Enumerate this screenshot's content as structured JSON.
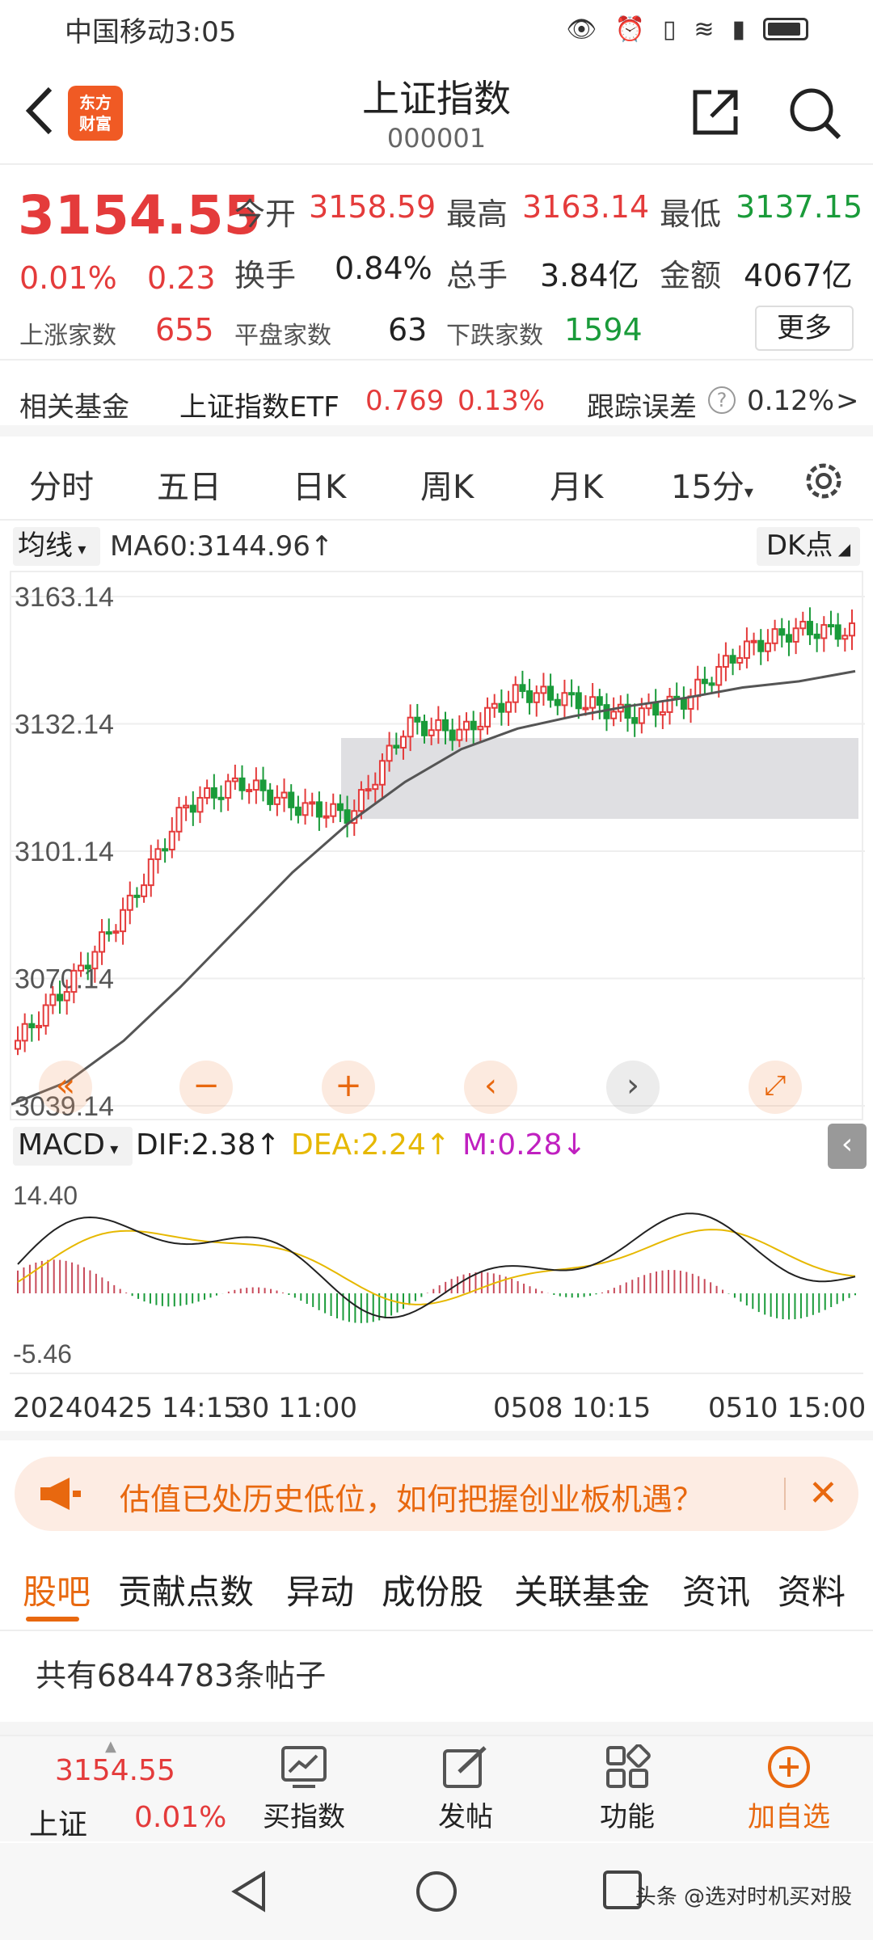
{
  "status": {
    "carrier_time": "中国移动3:05"
  },
  "nav": {
    "logo": "东方财富",
    "title": "上证指数",
    "code": "000001"
  },
  "quote": {
    "price": "3154.55",
    "change_pct": "0.01%",
    "change_val": "0.23",
    "open_label": "今开",
    "open": "3158.59",
    "high_label": "最高",
    "high": "3163.14",
    "low_label": "最低",
    "low": "3137.15",
    "turnover_label": "换手",
    "turnover": "0.84%",
    "volume_label": "总手",
    "volume": "3.84亿",
    "amount_label": "金额",
    "amount": "4067亿",
    "up_label": "上涨家数",
    "up": "655",
    "flat_label": "平盘家数",
    "flat": "63",
    "down_label": "下跌家数",
    "down": "1594",
    "more": "更多"
  },
  "fund": {
    "label": "相关基金",
    "name": "上证指数ETF",
    "price": "0.769",
    "pct": "0.13%",
    "error_label": "跟踪误差",
    "error_value": "0.12%",
    "chevron": ">"
  },
  "tabs": [
    "分时",
    "五日",
    "日K",
    "周K",
    "月K",
    "15分"
  ],
  "ma": {
    "select": "均线",
    "text": "MA60:3144.96↑",
    "dk": "DK点"
  },
  "chart_data": {
    "type": "line",
    "title": "",
    "y_ticks": [
      "3163.14",
      "3132.14",
      "3101.14",
      "3070.14",
      "3039.14"
    ],
    "ylim": [
      3039.14,
      3163.14
    ],
    "series": [
      {
        "name": "MA60",
        "values": [
          3039.5,
          3045,
          3055,
          3068,
          3082,
          3096,
          3108,
          3118,
          3126,
          3131,
          3134,
          3136.5,
          3138.5,
          3141,
          3142.5,
          3144.96
        ]
      }
    ],
    "close": [
      3055,
      3070,
      3088,
      3112,
      3118,
      3112,
      3110,
      3132,
      3130,
      3140,
      3138,
      3134,
      3138,
      3150,
      3155,
      3154.55
    ],
    "x_labels": [
      "20240425 14:15",
      "30 11:00",
      "0508 10:15",
      "0510 15:00"
    ],
    "grid": true
  },
  "chart_controls": [
    "«",
    "−",
    "+",
    "‹",
    "›",
    "⤢"
  ],
  "macd": {
    "select": "MACD",
    "dif": "DIF:2.38↑",
    "dea": "DEA:2.24↑",
    "m": "M:0.28↓",
    "y_top": "14.40",
    "y_bottom": "-5.46",
    "dif_color": "#222222",
    "dea_color": "#e6b800",
    "m_color": "#c020c0"
  },
  "banner": {
    "text": "估值已处历史低位，如何把握创业板机遇？"
  },
  "sections": [
    "股吧",
    "贡献点数",
    "异动",
    "成份股",
    "关联基金",
    "资讯",
    "资料"
  ],
  "posts": {
    "count_text": "共有6844783条帖子"
  },
  "bottom": {
    "price": "3154.55",
    "name": "上证",
    "pct": "0.01%",
    "buy": "买指数",
    "post": "发帖",
    "func": "功能",
    "add": "加自选"
  },
  "watermark": "头条 @选对时机买对股"
}
